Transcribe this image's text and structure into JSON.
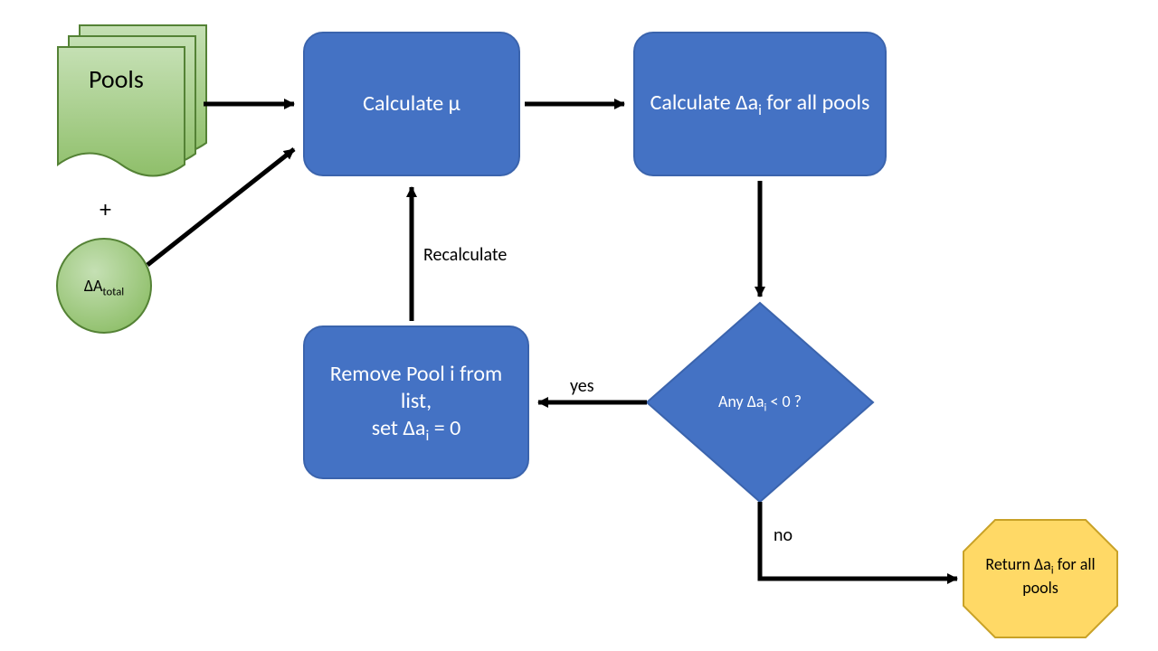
{
  "inputs": {
    "pools_label": "Pools",
    "plus": "+",
    "delta_a_total": "ΔA",
    "delta_a_total_sub": "total"
  },
  "nodes": {
    "calc_mu": "Calculate μ",
    "calc_dai_line1": "Calculate Δa",
    "calc_dai_sub": "i",
    "calc_dai_line2": " for all pools",
    "remove_line1": "Remove Pool i from list,",
    "remove_line2_pre": "set Δa",
    "remove_line2_sub": "i",
    "remove_line2_post": " = 0",
    "decision_pre": "Any Δa",
    "decision_sub": "i",
    "decision_post": " < 0 ?",
    "return_pre": "Return Δa",
    "return_sub": "i",
    "return_post": " for all pools"
  },
  "edges": {
    "recalculate": "Recalculate",
    "yes": "yes",
    "no": "no"
  },
  "colors": {
    "process_fill": "#4472c4",
    "process_stroke": "#3b64ad",
    "doc_fill": "#a9d18e",
    "doc_stroke": "#548235",
    "oct_fill": "#ffd966",
    "oct_stroke": "#c9a227",
    "arrow": "#000000"
  }
}
